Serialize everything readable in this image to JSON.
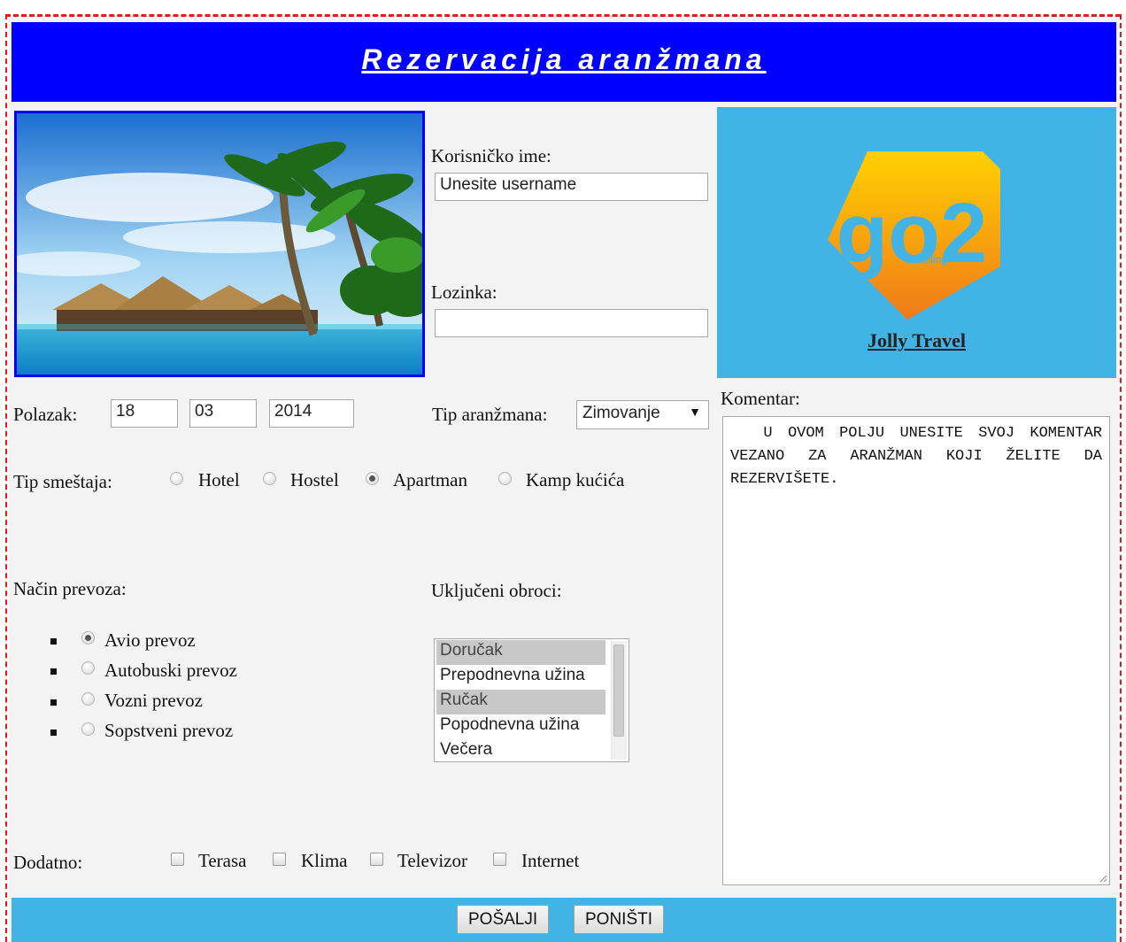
{
  "header": {
    "title": "Rezervacija aranžmana"
  },
  "login": {
    "username_label": "Korisničko ime:",
    "username_value": "Unesite username",
    "password_label": "Lozinka:",
    "password_value": ""
  },
  "logo": {
    "mark_text": "go2",
    "mark_subtext": "travelling",
    "caption": "Jolly Travel"
  },
  "departure": {
    "label": "Polazak:",
    "day": "18",
    "month": "03",
    "year": "2014"
  },
  "package_type": {
    "label": "Tip aranžmana:",
    "selected": "Zimovanje"
  },
  "accommodation": {
    "label": "Tip smeštaja:",
    "options": [
      "Hotel",
      "Hostel",
      "Apartman",
      "Kamp kućića"
    ],
    "selected": "Apartman"
  },
  "transport": {
    "label": "Način prevoza:",
    "options": [
      "Avio prevoz",
      "Autobuski prevoz",
      "Vozni prevoz",
      "Sopstveni prevoz"
    ],
    "selected": "Avio prevoz"
  },
  "meals": {
    "label": "Uključeni obroci:",
    "options": [
      "Doručak",
      "Prepodnevna užina",
      "Ručak",
      "Popodnevna užina",
      "Večera"
    ],
    "selected": [
      "Doručak",
      "Ručak"
    ]
  },
  "comment": {
    "label": "Komentar:",
    "text": "U OVOM POLJU UNESITE SVOJ KOMENTAR VEZANO ZA ARANŽMAN KOJI ŽELITE DA REZERVIŠETE."
  },
  "extras": {
    "label": "Dodatno:",
    "options": [
      "Terasa",
      "Klima",
      "Televizor",
      "Internet"
    ]
  },
  "footer": {
    "submit_label": "POŠALJI",
    "reset_label": "PONIŠTI"
  },
  "colors": {
    "header_bg": "#0000ff",
    "accent_bg": "#42b3e5",
    "frame_border": "#e8191e",
    "page_bg": "#f3f3f3"
  }
}
